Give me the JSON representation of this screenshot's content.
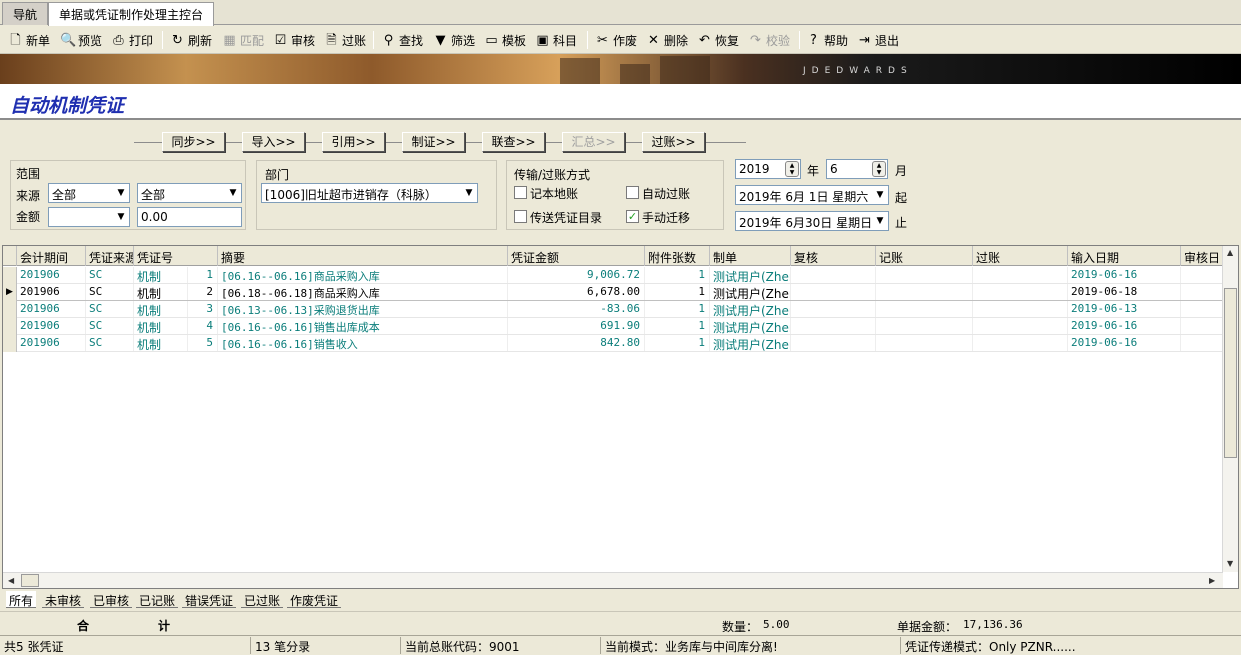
{
  "tabs": [
    {
      "label": "导航",
      "active": false
    },
    {
      "label": "单据或凭证制作处理主控台",
      "active": true
    }
  ],
  "toolbar": {
    "new": "新单",
    "preview": "预览",
    "print": "打印",
    "refresh": "刷新",
    "match": "匹配",
    "audit": "审核",
    "post": "过账",
    "find": "查找",
    "filter": "筛选",
    "template": "模板",
    "subject": "科目",
    "void": "作废",
    "delete": "删除",
    "restore": "恢复",
    "verify": "校验",
    "help": "帮助",
    "exit": "退出"
  },
  "banner": {
    "logo": "JDEDWARDS"
  },
  "page_title": "自动机制凭证",
  "flow_buttons": {
    "sync": "同步>>",
    "import": "导入>>",
    "reference": "引用>>",
    "make": "制证>>",
    "link": "联查>>",
    "summary": "汇总>>",
    "post": "过账>>"
  },
  "filters": {
    "range_title": "范围",
    "source_label": "来源",
    "source_value1": "全部",
    "source_value2": "全部",
    "amount_label": "金额",
    "amount_value1": "",
    "amount_value2": "0.00",
    "dept_title": "部门",
    "dept_value": "[1006]旧址超市进销存（科脉）",
    "transfer_title": "传输/过账方式",
    "opt_local": "记本地账",
    "opt_auto_post": "自动过账",
    "opt_send_dir": "传送凭证目录",
    "opt_manual": "手动迁移",
    "year_value": "2019",
    "year_label": "年",
    "month_value": "6",
    "month_label": "月",
    "start_date": "2019年 6月 1日",
    "start_weekday": "星期六",
    "start_label": "起",
    "end_date": "2019年 6月30日",
    "end_weekday": "星期日",
    "end_label": "止"
  },
  "table": {
    "columns": [
      "会计期间",
      "凭证来源",
      "凭证号",
      "摘要",
      "凭证金额",
      "附件张数",
      "制单",
      "复核",
      "记账",
      "过账",
      "输入日期",
      "审核日"
    ],
    "rows": [
      {
        "period": "201906",
        "source": "SC",
        "type": "机制",
        "no": "1",
        "summary": "[06.16--06.16]商品采购入库",
        "amount": "9,006.72",
        "attach": "1",
        "maker": "测试用户(Zhen",
        "review": "",
        "book": "",
        "posted": "",
        "input_date": "2019-06-16"
      },
      {
        "period": "201906",
        "source": "SC",
        "type": "机制",
        "no": "2",
        "summary": "[06.18--06.18]商品采购入库",
        "amount": "6,678.00",
        "attach": "1",
        "maker": "测试用户(Zhen",
        "review": "",
        "book": "",
        "posted": "",
        "input_date": "2019-06-18"
      },
      {
        "period": "201906",
        "source": "SC",
        "type": "机制",
        "no": "3",
        "summary": "[06.13--06.13]采购退货出库",
        "amount": "-83.06",
        "attach": "1",
        "maker": "测试用户(Zhen",
        "review": "",
        "book": "",
        "posted": "",
        "input_date": "2019-06-13"
      },
      {
        "period": "201906",
        "source": "SC",
        "type": "机制",
        "no": "4",
        "summary": "[06.16--06.16]销售出库成本",
        "amount": "691.90",
        "attach": "1",
        "maker": "测试用户(Zhen",
        "review": "",
        "book": "",
        "posted": "",
        "input_date": "2019-06-16"
      },
      {
        "period": "201906",
        "source": "SC",
        "type": "机制",
        "no": "5",
        "summary": "[06.16--06.16]销售收入",
        "amount": "842.80",
        "attach": "1",
        "maker": "测试用户(Zhen",
        "review": "",
        "book": "",
        "posted": "",
        "input_date": "2019-06-16"
      }
    ],
    "selected_row": 1
  },
  "bottom_tabs": [
    "所有",
    "未审核",
    "已审核",
    "已记账",
    "错误凭证",
    "已过账",
    "作废凭证"
  ],
  "totals": {
    "label1": "合",
    "label2": "计",
    "qty_label": "数量：",
    "qty_value": "5.00",
    "amount_label": "单据金额：",
    "amount_value": "17,136.36"
  },
  "status": {
    "count": "共5 张凭证",
    "entries": "13 笔分录",
    "ledger": "当前总账代码：9001",
    "mode": "当前模式：业务库与中间库分离!",
    "transfer": "凭证传递模式：Only PZNR......"
  },
  "colors": {
    "title": "#1f2fb0",
    "teal_text": "#0a7d7a"
  }
}
